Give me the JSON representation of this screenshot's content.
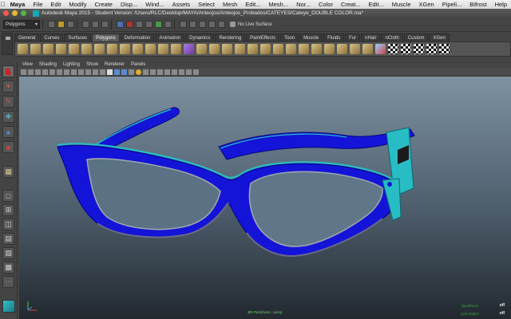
{
  "menubar": {
    "items": [
      "Maya",
      "File",
      "Edit",
      "Modify",
      "Create",
      "Disp...",
      "Wind...",
      "Assets",
      "Select",
      "Mesh",
      "Edit...",
      "Mesh...",
      "Nor...",
      "Color",
      "Creat...",
      "Edit...",
      "Muscle",
      "XGen",
      "Pipeli...",
      "Bifrost",
      "Help"
    ]
  },
  "window": {
    "title": "Autodesk Maya 2015 - Student Version: /Users/RLC/Desktop/MAYA/Anteojos/Anteojos_Probados/CATEYES/Cateye_DOUBLE COLOR.ma*"
  },
  "status_line": {
    "mode": "Polygons",
    "live_surface": "No Live Surface"
  },
  "shelf": {
    "tabs": [
      "General",
      "Curves",
      "Surfaces",
      "Polygons",
      "Deformation",
      "Animation",
      "Dynamics",
      "Rendering",
      "PaintEffects",
      "Toon",
      "Muscle",
      "Fluids",
      "Fur",
      "nHair",
      "nCloth",
      "Custom",
      "XGen"
    ],
    "active_tab": "Polygons"
  },
  "viewport": {
    "menu": [
      "View",
      "Shading",
      "Lighting",
      "Show",
      "Renderer",
      "Panels"
    ],
    "hud": {
      "camera_label": "BR Pan/Zoom : persp",
      "backfaces_label": "Backfaces:",
      "backfaces_value": "off",
      "soft_select_label": "Soft Select:",
      "soft_select_value": "off"
    }
  },
  "colors": {
    "frame_blue": "#1414d8",
    "frame_cyan": "#28bcc4",
    "viewport_top": "#7e92a2",
    "viewport_bottom": "#22292f"
  }
}
